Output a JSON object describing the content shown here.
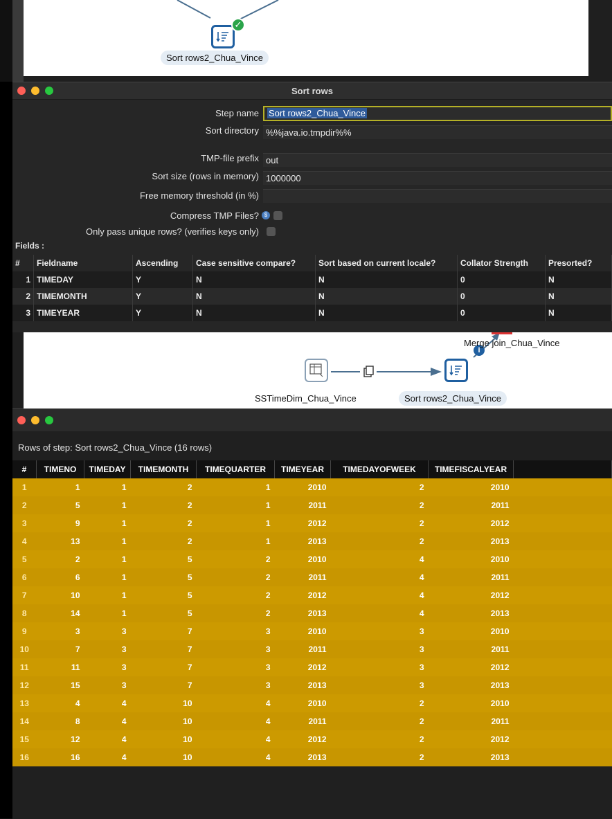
{
  "canvas_top": {
    "node_label": "Sort rows2_Chua_Vince"
  },
  "dialog": {
    "title": "Sort rows",
    "step_name_label": "Step name",
    "step_name_value": "Sort rows2_Chua_Vince",
    "sort_directory_label": "Sort directory",
    "sort_directory_value": "%%java.io.tmpdir%%",
    "tmp_prefix_label": "TMP-file prefix",
    "tmp_prefix_value": "out",
    "sort_size_label": "Sort size (rows in memory)",
    "sort_size_value": "1000000",
    "free_memory_label": "Free memory threshold (in %)",
    "free_memory_value": "",
    "compress_label": "Compress TMP Files?",
    "unique_label": "Only pass unique rows? (verifies keys only)",
    "fields_label": "Fields :",
    "columns": [
      "#",
      "Fieldname",
      "Ascending",
      "Case sensitive compare?",
      "Sort based on current locale?",
      "Collator Strength",
      "Presorted?"
    ],
    "rows": [
      [
        "1",
        "TIMEDAY",
        "Y",
        "N",
        "N",
        "0",
        "N"
      ],
      [
        "2",
        "TIMEMONTH",
        "Y",
        "N",
        "N",
        "0",
        "N"
      ],
      [
        "3",
        "TIMEYEAR",
        "Y",
        "N",
        "N",
        "0",
        "N"
      ]
    ]
  },
  "canvas_mid": {
    "merge_label": "Merge join_Chua_Vince",
    "source_label": "SSTimeDim_Chua_Vince",
    "sort_label": "Sort rows2_Chua_Vince"
  },
  "preview": {
    "caption": "Rows of step: Sort rows2_Chua_Vince (16 rows)",
    "columns": [
      "#",
      "TIMENO",
      "TIMEDAY",
      "TIMEMONTH",
      "TIMEQUARTER",
      "TIMEYEAR",
      "TIMEDAYOFWEEK",
      "TIMEFISCALYEAR"
    ],
    "rows": [
      [
        "1",
        "1",
        "1",
        "2",
        "1",
        "2010",
        "2",
        "2010"
      ],
      [
        "2",
        "5",
        "1",
        "2",
        "1",
        "2011",
        "2",
        "2011"
      ],
      [
        "3",
        "9",
        "1",
        "2",
        "1",
        "2012",
        "2",
        "2012"
      ],
      [
        "4",
        "13",
        "1",
        "2",
        "1",
        "2013",
        "2",
        "2013"
      ],
      [
        "5",
        "2",
        "1",
        "5",
        "2",
        "2010",
        "4",
        "2010"
      ],
      [
        "6",
        "6",
        "1",
        "5",
        "2",
        "2011",
        "4",
        "2011"
      ],
      [
        "7",
        "10",
        "1",
        "5",
        "2",
        "2012",
        "4",
        "2012"
      ],
      [
        "8",
        "14",
        "1",
        "5",
        "2",
        "2013",
        "4",
        "2013"
      ],
      [
        "9",
        "3",
        "3",
        "7",
        "3",
        "2010",
        "3",
        "2010"
      ],
      [
        "10",
        "7",
        "3",
        "7",
        "3",
        "2011",
        "3",
        "2011"
      ],
      [
        "11",
        "11",
        "3",
        "7",
        "3",
        "2012",
        "3",
        "2012"
      ],
      [
        "12",
        "15",
        "3",
        "7",
        "3",
        "2013",
        "3",
        "2013"
      ],
      [
        "13",
        "4",
        "4",
        "10",
        "4",
        "2010",
        "2",
        "2010"
      ],
      [
        "14",
        "8",
        "4",
        "10",
        "4",
        "2011",
        "2",
        "2011"
      ],
      [
        "15",
        "12",
        "4",
        "10",
        "4",
        "2012",
        "2",
        "2012"
      ],
      [
        "16",
        "16",
        "4",
        "10",
        "4",
        "2013",
        "2",
        "2013"
      ]
    ]
  },
  "colors": {
    "accent": "#cc9a00",
    "window_red": "#ff5f57",
    "window_yellow": "#febc2e",
    "window_green": "#28c840",
    "node_blue": "#1f5fa0"
  }
}
